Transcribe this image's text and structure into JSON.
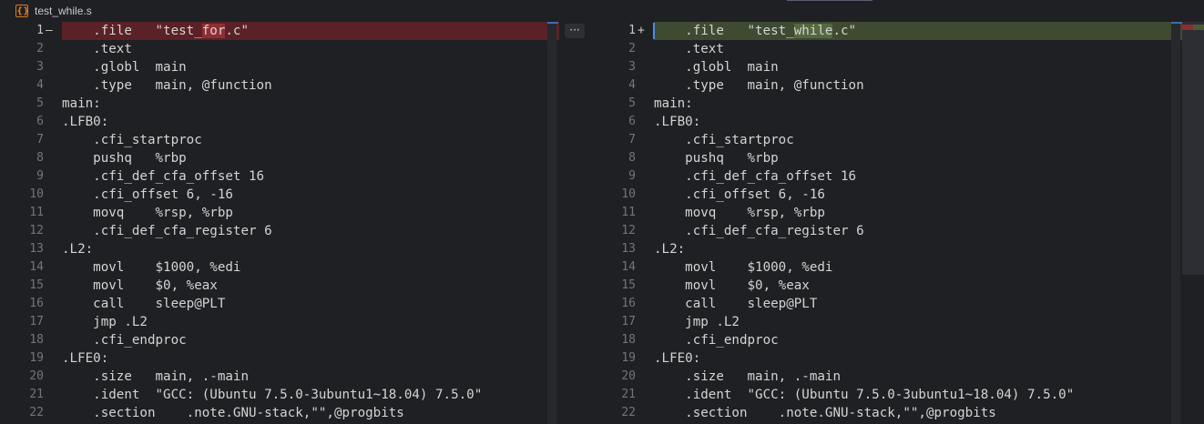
{
  "file": {
    "name": "test_while.s",
    "icon": "asm-file-icon"
  },
  "colors": {
    "deleted_line": "#5a2126",
    "deleted_word": "#8f2e35",
    "added_line": "#3f4a32",
    "added_word": "#55683f",
    "cursor": "#4a8ee8"
  },
  "toolbar": {
    "more_label": "···"
  },
  "left": {
    "lines": [
      {
        "n": "1",
        "m": "—",
        "pre": "    .file   \"test_",
        "hl": "for",
        "post": ".c\"",
        "kind": "del"
      },
      {
        "n": "2",
        "m": "",
        "text": "    .text"
      },
      {
        "n": "3",
        "m": "",
        "text": "    .globl  main"
      },
      {
        "n": "4",
        "m": "",
        "text": "    .type   main, @function"
      },
      {
        "n": "5",
        "m": "",
        "text": "main:"
      },
      {
        "n": "6",
        "m": "",
        "text": ".LFB0:"
      },
      {
        "n": "7",
        "m": "",
        "text": "    .cfi_startproc"
      },
      {
        "n": "8",
        "m": "",
        "text": "    pushq   %rbp"
      },
      {
        "n": "9",
        "m": "",
        "text": "    .cfi_def_cfa_offset 16"
      },
      {
        "n": "10",
        "m": "",
        "text": "    .cfi_offset 6, -16"
      },
      {
        "n": "11",
        "m": "",
        "text": "    movq    %rsp, %rbp"
      },
      {
        "n": "12",
        "m": "",
        "text": "    .cfi_def_cfa_register 6"
      },
      {
        "n": "13",
        "m": "",
        "text": ".L2:"
      },
      {
        "n": "14",
        "m": "",
        "text": "    movl    $1000, %edi"
      },
      {
        "n": "15",
        "m": "",
        "text": "    movl    $0, %eax"
      },
      {
        "n": "16",
        "m": "",
        "text": "    call    sleep@PLT"
      },
      {
        "n": "17",
        "m": "",
        "text": "    jmp .L2"
      },
      {
        "n": "18",
        "m": "",
        "text": "    .cfi_endproc"
      },
      {
        "n": "19",
        "m": "",
        "text": ".LFE0:"
      },
      {
        "n": "20",
        "m": "",
        "text": "    .size   main, .-main"
      },
      {
        "n": "21",
        "m": "",
        "text": "    .ident  \"GCC: (Ubuntu 7.5.0-3ubuntu1~18.04) 7.5.0\""
      },
      {
        "n": "22",
        "m": "",
        "text": "    .section    .note.GNU-stack,\"\",@progbits"
      }
    ]
  },
  "right": {
    "lines": [
      {
        "n": "1",
        "m": "+",
        "pre": "    .file   \"test_",
        "hl": "while",
        "post": ".c\"",
        "kind": "add"
      },
      {
        "n": "2",
        "m": "",
        "text": "    .text"
      },
      {
        "n": "3",
        "m": "",
        "text": "    .globl  main"
      },
      {
        "n": "4",
        "m": "",
        "text": "    .type   main, @function"
      },
      {
        "n": "5",
        "m": "",
        "text": "main:"
      },
      {
        "n": "6",
        "m": "",
        "text": ".LFB0:"
      },
      {
        "n": "7",
        "m": "",
        "text": "    .cfi_startproc"
      },
      {
        "n": "8",
        "m": "",
        "text": "    pushq   %rbp"
      },
      {
        "n": "9",
        "m": "",
        "text": "    .cfi_def_cfa_offset 16"
      },
      {
        "n": "10",
        "m": "",
        "text": "    .cfi_offset 6, -16"
      },
      {
        "n": "11",
        "m": "",
        "text": "    movq    %rsp, %rbp"
      },
      {
        "n": "12",
        "m": "",
        "text": "    .cfi_def_cfa_register 6"
      },
      {
        "n": "13",
        "m": "",
        "text": ".L2:"
      },
      {
        "n": "14",
        "m": "",
        "text": "    movl    $1000, %edi"
      },
      {
        "n": "15",
        "m": "",
        "text": "    movl    $0, %eax"
      },
      {
        "n": "16",
        "m": "",
        "text": "    call    sleep@PLT"
      },
      {
        "n": "17",
        "m": "",
        "text": "    jmp .L2"
      },
      {
        "n": "18",
        "m": "",
        "text": "    .cfi_endproc"
      },
      {
        "n": "19",
        "m": "",
        "text": ".LFE0:"
      },
      {
        "n": "20",
        "m": "",
        "text": "    .size   main, .-main"
      },
      {
        "n": "21",
        "m": "",
        "text": "    .ident  \"GCC: (Ubuntu 7.5.0-3ubuntu1~18.04) 7.5.0\""
      },
      {
        "n": "22",
        "m": "",
        "text": "    .section    .note.GNU-stack,\"\",@progbits"
      }
    ]
  }
}
